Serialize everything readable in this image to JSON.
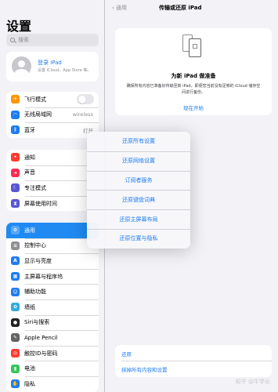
{
  "sidebar": {
    "title": "设置",
    "search_placeholder": "搜索",
    "account": {
      "name": "登录 iPad",
      "subtitle": "设置 iCloud、App Store 等。"
    },
    "group1": [
      {
        "label": "飞行模式",
        "icon": "airplane-icon",
        "color": "#ff9500",
        "toggle": false
      },
      {
        "label": "无线局域网",
        "icon": "wifi-icon",
        "color": "#1f7cf0",
        "value": "wireless"
      },
      {
        "label": "蓝牙",
        "icon": "bluetooth-icon",
        "color": "#1f7cf0",
        "value": "打开"
      }
    ],
    "group2": [
      {
        "label": "通知",
        "icon": "bell-icon",
        "color": "#ff3b30"
      },
      {
        "label": "声音",
        "icon": "speaker-icon",
        "color": "#ff2d55"
      },
      {
        "label": "专注模式",
        "icon": "moon-icon",
        "color": "#5856d6"
      },
      {
        "label": "屏幕使用时间",
        "icon": "hourglass-icon",
        "color": "#5856d6"
      }
    ],
    "group3": [
      {
        "label": "通用",
        "icon": "gear-icon",
        "color": "#8e8e93",
        "active": true
      },
      {
        "label": "控制中心",
        "icon": "switches-icon",
        "color": "#8e8e93"
      },
      {
        "label": "显示与亮度",
        "icon": "text-size-icon",
        "color": "#1f7cf0"
      },
      {
        "label": "主屏幕与程序坞",
        "icon": "grid-icon",
        "color": "#1f7cf0"
      },
      {
        "label": "辅助功能",
        "icon": "accessibility-icon",
        "color": "#1f7cf0"
      },
      {
        "label": "墙纸",
        "icon": "flower-icon",
        "color": "#34aadc"
      },
      {
        "label": "Siri与搜索",
        "icon": "siri-icon",
        "color": "#222222"
      },
      {
        "label": "Apple Pencil",
        "icon": "pencil-icon",
        "color": "#636366"
      },
      {
        "label": "触控ID与密码",
        "icon": "fingerprint-icon",
        "color": "#ff3b30"
      },
      {
        "label": "电池",
        "icon": "battery-icon",
        "color": "#34c759"
      },
      {
        "label": "隐私",
        "icon": "hand-icon",
        "color": "#1f7cf0"
      }
    ]
  },
  "nav": {
    "back_label": "通用",
    "title": "传输或还原 iPad"
  },
  "card": {
    "title": "为新 iPad 做准备",
    "description": "确保所有内容已准备好传输至新 iPad，即便您当前没有足够的 iCloud 储存空间进行备份。",
    "link": "现在开始"
  },
  "bottom": {
    "reset_label": "还原",
    "erase_label": "抹掉所有内容和设置"
  },
  "popup": {
    "items": [
      "还原所有设置",
      "还原网络设置",
      "订阅者服务",
      "还原键盘词典",
      "还原主屏幕布局",
      "还原位置与隐私"
    ]
  },
  "watermark": "知乎 @牛学长"
}
